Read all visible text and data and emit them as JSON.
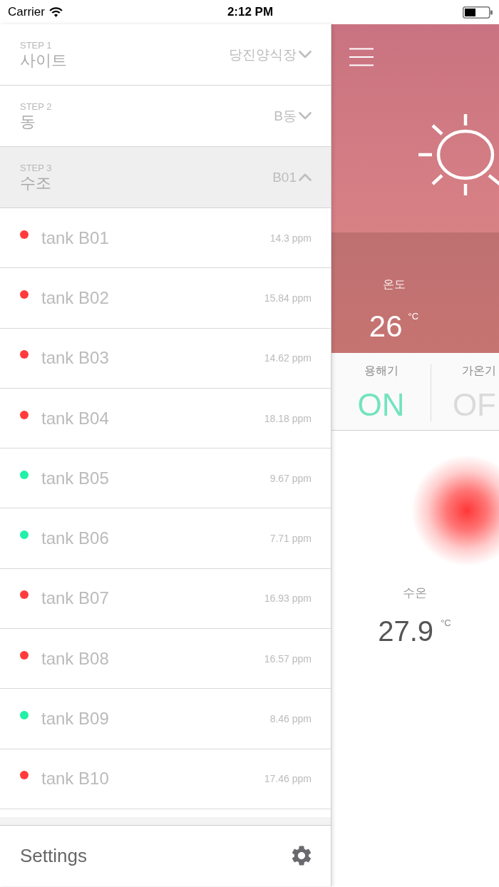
{
  "status_bar": {
    "carrier": "Carrier",
    "time": "2:12 PM"
  },
  "drawer": {
    "steps": [
      {
        "step": "STEP 1",
        "title": "사이트",
        "value": "당진양식장",
        "expanded": false
      },
      {
        "step": "STEP 2",
        "title": "동",
        "value": "B동",
        "expanded": false
      },
      {
        "step": "STEP 3",
        "title": "수조",
        "value": "B01",
        "expanded": true
      }
    ],
    "tanks": [
      {
        "name": "tank B01",
        "reading": "14.3 ppm",
        "color": "#ff3b3b"
      },
      {
        "name": "tank B02",
        "reading": "15.84 ppm",
        "color": "#ff3b3b"
      },
      {
        "name": "tank B03",
        "reading": "14.62 ppm",
        "color": "#ff3b3b"
      },
      {
        "name": "tank B04",
        "reading": "18.18 ppm",
        "color": "#ff3b3b"
      },
      {
        "name": "tank B05",
        "reading": "9.67 ppm",
        "color": "#22f0a8"
      },
      {
        "name": "tank B06",
        "reading": "7.71 ppm",
        "color": "#22f0a8"
      },
      {
        "name": "tank B07",
        "reading": "16.93 ppm",
        "color": "#ff3b3b"
      },
      {
        "name": "tank B08",
        "reading": "16.57 ppm",
        "color": "#ff3b3b"
      },
      {
        "name": "tank B09",
        "reading": "8.46 ppm",
        "color": "#22f0a8"
      },
      {
        "name": "tank B10",
        "reading": "17.46 ppm",
        "color": "#ff3b3b"
      }
    ],
    "settings": {
      "label": "Settings"
    }
  },
  "main": {
    "weather": {
      "kind": "sunny"
    },
    "air": {
      "label": "온도",
      "value": "26",
      "unit": "°C"
    },
    "devices": [
      {
        "label": "용해기",
        "state": "ON",
        "on": true
      },
      {
        "label": "가온기",
        "state": "OF",
        "on": false
      }
    ],
    "water": {
      "label": "수온",
      "value": "27.9",
      "unit": "°C"
    }
  }
}
